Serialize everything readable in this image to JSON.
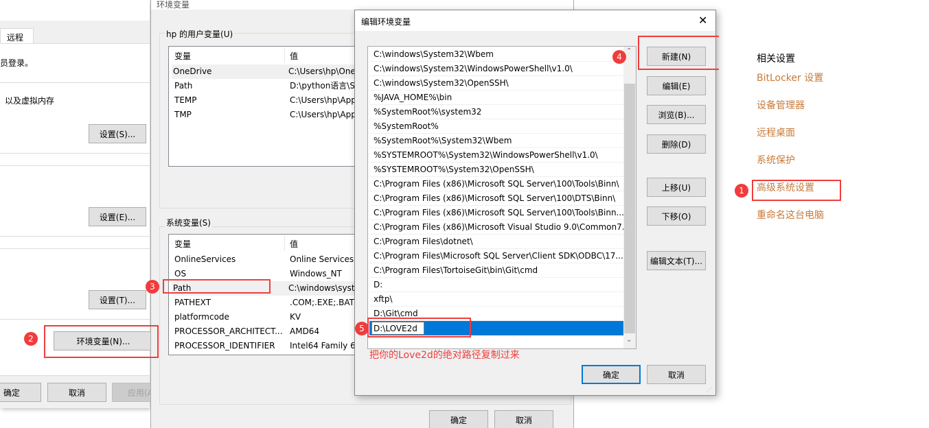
{
  "system_properties": {
    "tab_remote": "远程",
    "text_login": "员登录。",
    "text_memory": "以及虚拟内存",
    "btn_settings_s": "设置(S)...",
    "btn_settings_e": "设置(E)...",
    "btn_settings_t": "设置(T)...",
    "btn_env_vars": "环境变量(N)...",
    "btn_ok": "确定",
    "btn_cancel": "取消",
    "btn_apply": "应用(A)"
  },
  "env_dialog": {
    "title": "环境变量",
    "user_group": "hp 的用户变量(U)",
    "system_group": "系统变量(S)",
    "col_var": "变量",
    "col_val": "值",
    "user_vars": [
      {
        "name": "OneDrive",
        "value": "C:\\Users\\hp\\One"
      },
      {
        "name": "Path",
        "value": "D:\\python语言\\Sc"
      },
      {
        "name": "TEMP",
        "value": "C:\\Users\\hp\\App"
      },
      {
        "name": "TMP",
        "value": "C:\\Users\\hp\\App"
      }
    ],
    "system_vars": [
      {
        "name": "OnlineServices",
        "value": "Online Services"
      },
      {
        "name": "OS",
        "value": "Windows_NT"
      },
      {
        "name": "Path",
        "value": "C:\\windows\\syste"
      },
      {
        "name": "PATHEXT",
        "value": ".COM;.EXE;.BAT;."
      },
      {
        "name": "platformcode",
        "value": "KV"
      },
      {
        "name": "PROCESSOR_ARCHITECT...",
        "value": "AMD64"
      },
      {
        "name": "PROCESSOR_IDENTIFIER",
        "value": "Intel64 Family 6"
      }
    ],
    "btn_ok": "确定",
    "btn_cancel": "取消"
  },
  "edit_dialog": {
    "title": "编辑环境变量",
    "paths": [
      "C:\\windows\\System32\\Wbem",
      "C:\\windows\\System32\\WindowsPowerShell\\v1.0\\",
      "C:\\windows\\System32\\OpenSSH\\",
      "%JAVA_HOME%\\bin",
      "%SystemRoot%\\system32",
      "%SystemRoot%",
      "%SystemRoot%\\System32\\Wbem",
      "%SYSTEMROOT%\\System32\\WindowsPowerShell\\v1.0\\",
      "%SYSTEMROOT%\\System32\\OpenSSH\\",
      "C:\\Program Files (x86)\\Microsoft SQL Server\\100\\Tools\\Binn\\",
      "C:\\Program Files (x86)\\Microsoft SQL Server\\100\\DTS\\Binn\\",
      "C:\\Program Files (x86)\\Microsoft SQL Server\\100\\Tools\\Binn...",
      "C:\\Program Files (x86)\\Microsoft Visual Studio 9.0\\Common7...",
      "C:\\Program Files\\dotnet\\",
      "C:\\Program Files\\Microsoft SQL Server\\Client SDK\\ODBC\\17...",
      "C:\\Program Files\\TortoiseGit\\bin\\Git\\cmd",
      "D:",
      "xftp\\",
      "D:\\Git\\cmd"
    ],
    "editing_value": "D:\\LOVE2d",
    "btn_new": "新建(N)",
    "btn_edit": "编辑(E)",
    "btn_browse": "浏览(B)...",
    "btn_delete": "删除(D)",
    "btn_up": "上移(U)",
    "btn_down": "下移(O)",
    "btn_edit_text": "编辑文本(T)...",
    "btn_ok": "确定",
    "btn_cancel": "取消",
    "close_glyph": "✕"
  },
  "annotation": {
    "note": "把你的Love2d的绝对路径复制过来",
    "steps": [
      "1",
      "2",
      "3",
      "4",
      "5"
    ],
    "color": "#f03c3c"
  },
  "related": {
    "title": "相关设置",
    "links": [
      "BitLocker 设置",
      "设备管理器",
      "远程桌面",
      "系统保护",
      "高级系统设置",
      "重命名这台电脑"
    ],
    "link_color": "#c87a3a"
  }
}
